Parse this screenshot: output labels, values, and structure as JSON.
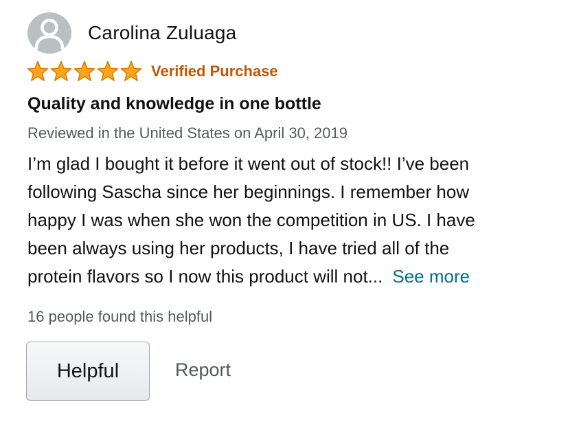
{
  "reviewer": {
    "name": "Carolina Zuluaga",
    "avatar_icon": "default-user-avatar-icon"
  },
  "rating": {
    "stars": 5,
    "max_stars": 5,
    "star_color": "#ffa41c",
    "verified_label": "Verified Purchase"
  },
  "review": {
    "title": "Quality and knowledge in one bottle",
    "meta": "Reviewed in the United States on April 30, 2019",
    "body_lines": [
      "I’m glad I bought it before it went out of stock!! I’ve been",
      "following Sascha since her beginnings. I remember how",
      "happy I was when she won the competition in US. I have",
      "been always using her products, I have tried all of the",
      "protein flavors so I now this product will not..."
    ],
    "see_more_label": "See more"
  },
  "footer": {
    "helpful_count": "16 people found this helpful",
    "helpful_button_label": "Helpful",
    "report_label": "Report"
  },
  "colors": {
    "verified": "#c45500",
    "link": "#007185",
    "secondary_text": "#565959"
  }
}
